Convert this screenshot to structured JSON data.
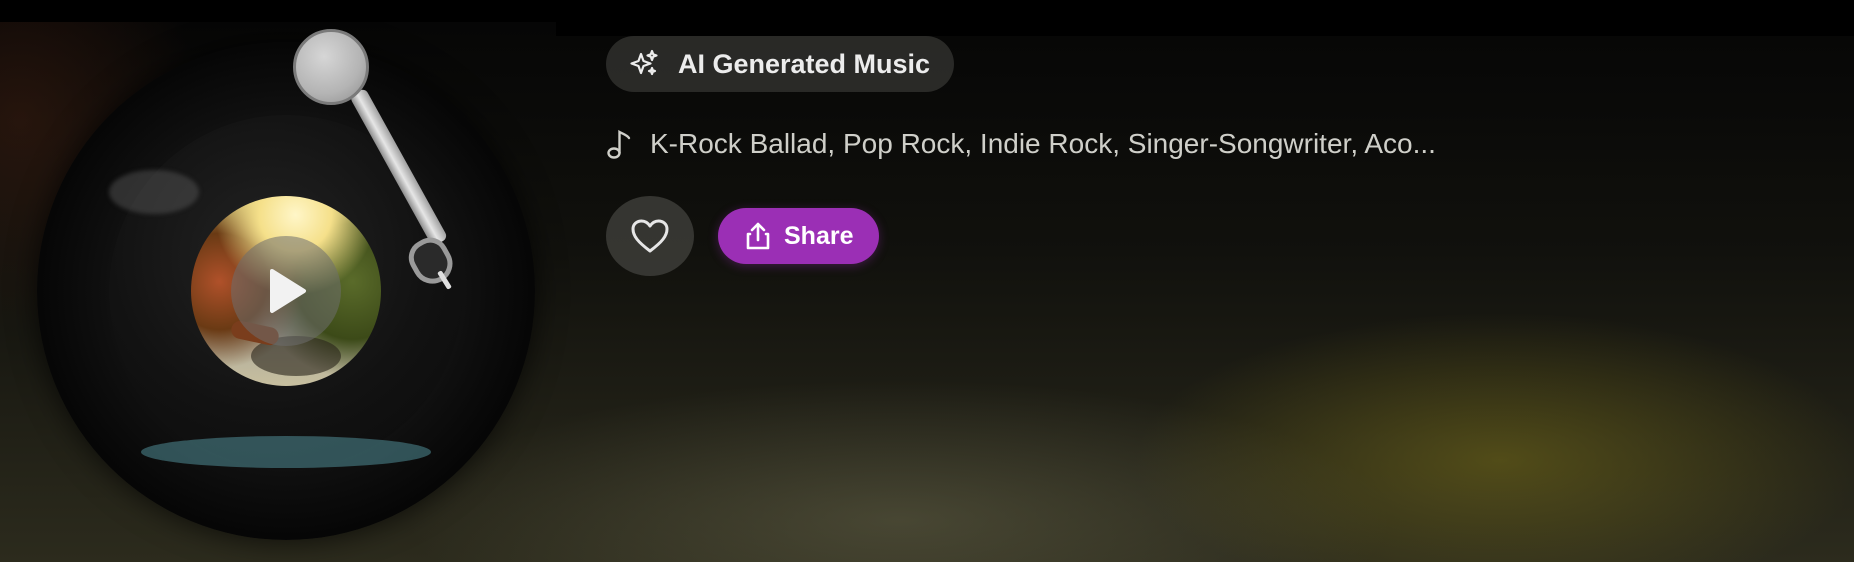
{
  "badge": {
    "icon": "sparkles-icon",
    "label": "AI Generated Music"
  },
  "genres": {
    "icon": "music-note-icon",
    "text": "K-Rock Ballad, Pop Rock, Indie Rock, Singer-Songwriter, Aco..."
  },
  "actions": {
    "like": {
      "icon": "heart-icon"
    },
    "share": {
      "icon": "share-icon",
      "label": "Share"
    }
  },
  "player": {
    "play_icon": "play-icon"
  },
  "colors": {
    "accent": "#9b2fb5",
    "badge_bg": "#464642",
    "text": "#ececec"
  }
}
